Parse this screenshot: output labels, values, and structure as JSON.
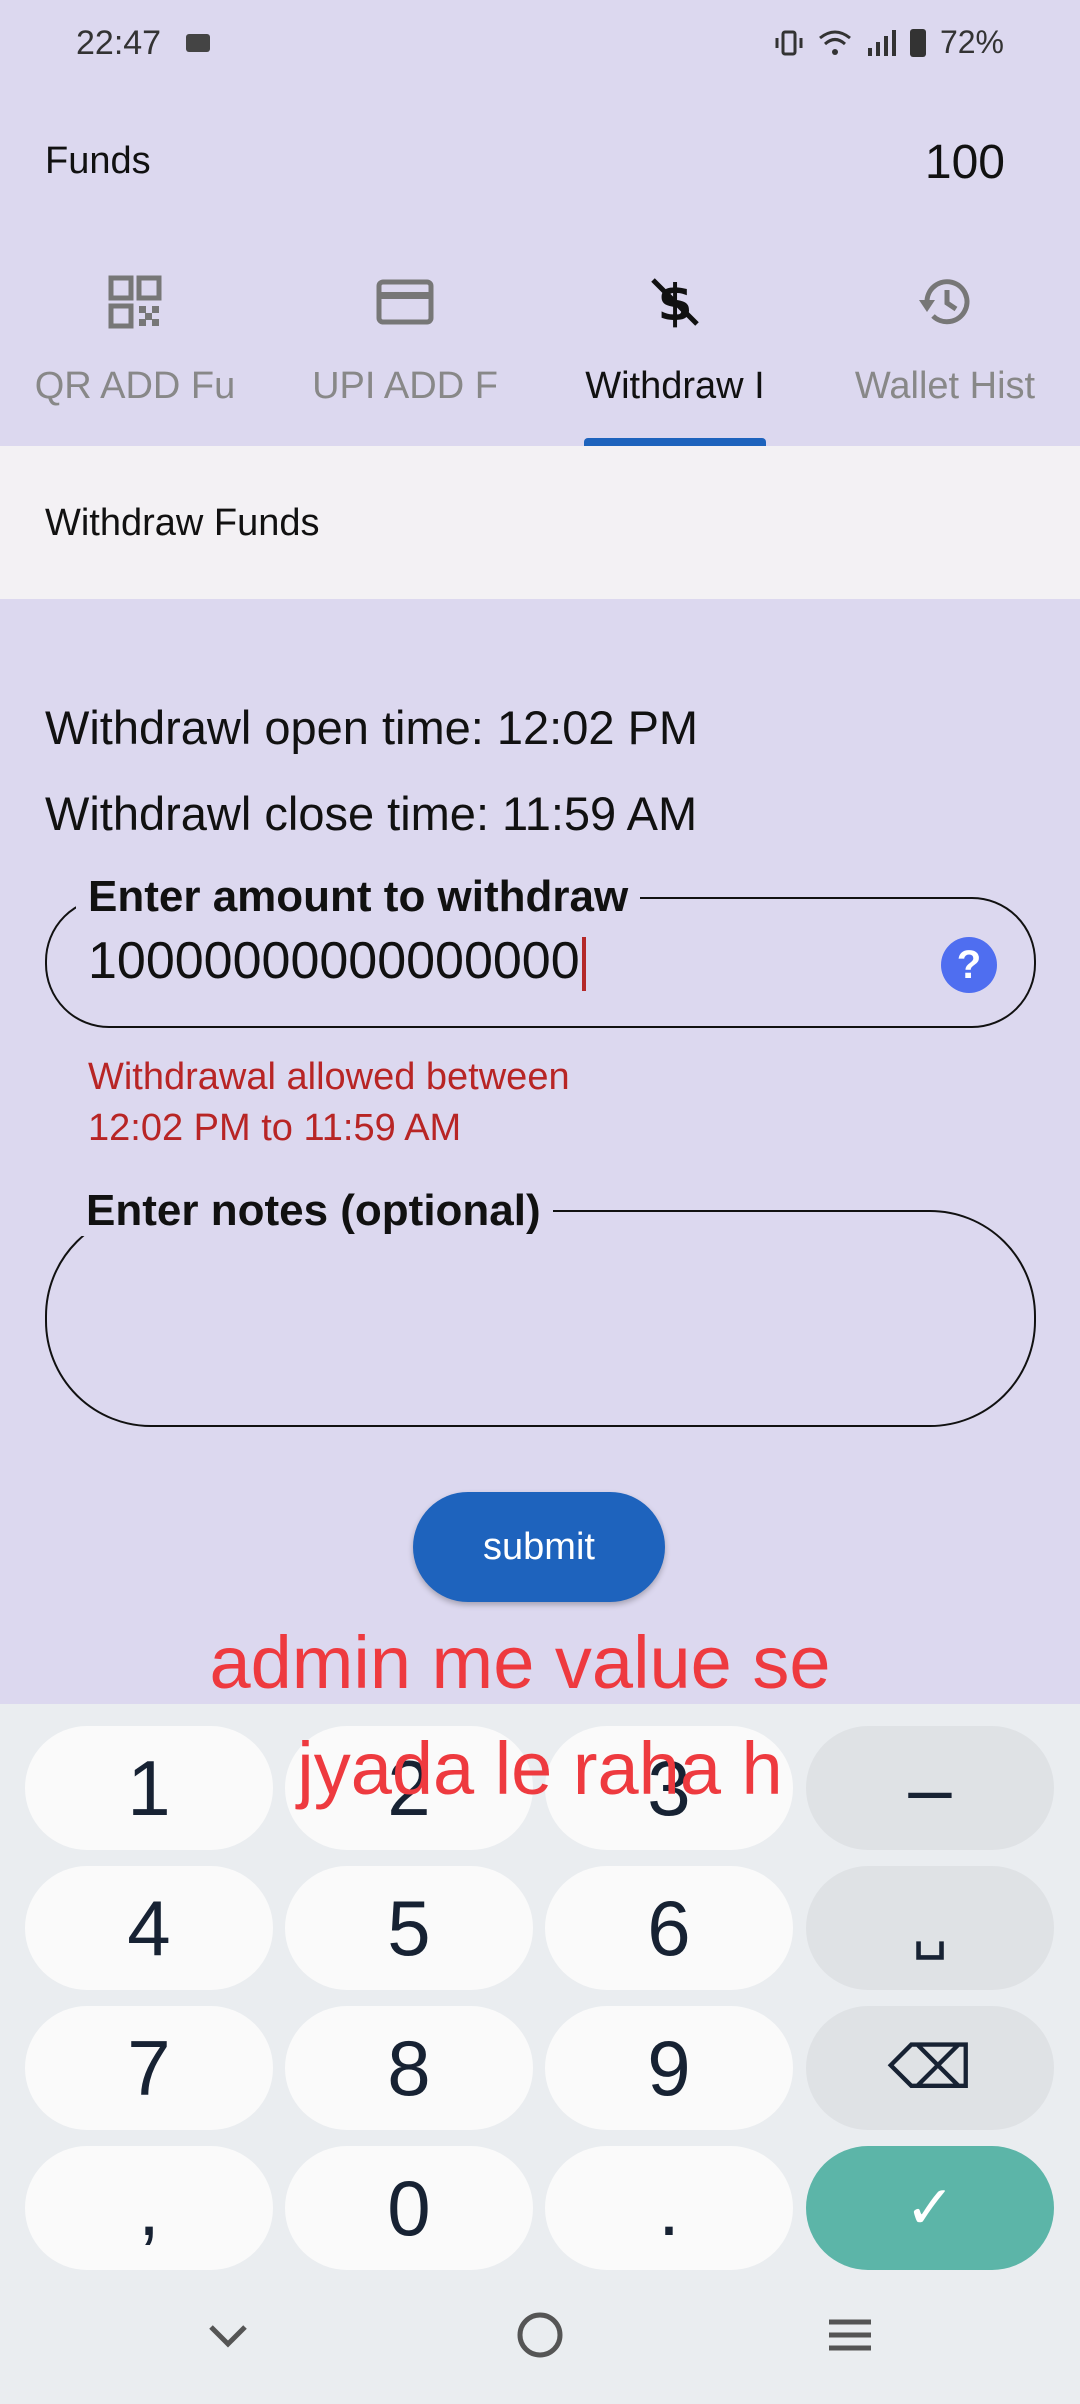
{
  "status_bar": {
    "time": "22:47",
    "battery": "72%"
  },
  "header": {
    "title": "Funds",
    "balance": "100"
  },
  "tabs": [
    {
      "label": "QR ADD Fu",
      "icon": "qr-code-icon"
    },
    {
      "label": "UPI ADD F",
      "icon": "credit-card-icon"
    },
    {
      "label": "Withdraw I",
      "icon": "money-off-icon"
    },
    {
      "label": "Wallet Hist",
      "icon": "history-icon"
    }
  ],
  "section_title": "Withdraw Funds",
  "info": {
    "open_time": "Withdrawl open time: 12:02 PM",
    "close_time": "Withdrawl close  time: 11:59 AM"
  },
  "amount_field": {
    "label": "Enter amount to withdraw",
    "value": "10000000000000000"
  },
  "error": {
    "line1": "Withdrawal allowed between",
    "line2": "12:02 PM to 11:59 AM"
  },
  "notes_field": {
    "label": "Enter notes (optional)",
    "value": ""
  },
  "submit_label": "submit",
  "annotation": {
    "line1": "admin me value se",
    "line2": "jyada le raha h"
  },
  "keyboard": {
    "rows": [
      [
        "1",
        "2",
        "3",
        "–"
      ],
      [
        "4",
        "5",
        "6",
        "␣"
      ],
      [
        "7",
        "8",
        "9",
        "⌫"
      ],
      [
        ",",
        "0",
        ".",
        "✓"
      ]
    ]
  },
  "colors": {
    "accent": "#1e63bd",
    "error": "#b82525",
    "background": "#dcd8ef",
    "annotation": "#ee3a3f",
    "confirm_key": "#5cb5a8"
  }
}
